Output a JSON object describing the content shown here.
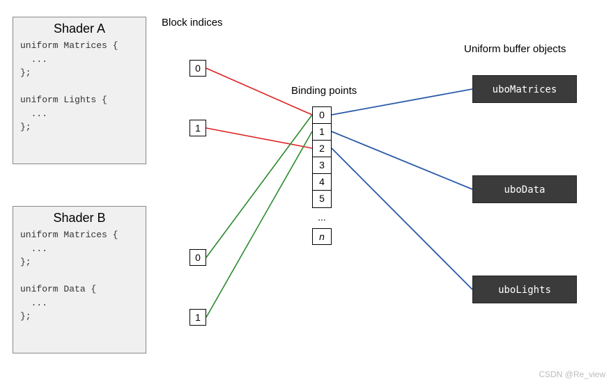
{
  "shaderA": {
    "title": "Shader A",
    "code": "uniform Matrices {\n  ...\n};\n\nuniform Lights {\n  ...\n};"
  },
  "shaderB": {
    "title": "Shader B",
    "code": "uniform Matrices {\n  ...\n};\n\nuniform Data {\n  ...\n};"
  },
  "labels": {
    "blockIndices": "Block indices",
    "bindingPoints": "Binding points",
    "ubo": "Uniform buffer objects"
  },
  "blockIdx": {
    "a0": "0",
    "a1": "1",
    "b0": "0",
    "b1": "1"
  },
  "bindPts": {
    "p0": "0",
    "p1": "1",
    "p2": "2",
    "p3": "3",
    "p4": "4",
    "p5": "5",
    "dots": "...",
    "n": "n"
  },
  "ubo": {
    "matrices": "uboMatrices",
    "data": "uboData",
    "lights": "uboLights"
  },
  "watermark": "CSDN @Re_view",
  "chart_data": {
    "type": "diagram",
    "title": "Uniform buffer object binding diagram",
    "shaders": [
      {
        "name": "Shader A",
        "blocks": [
          {
            "name": "Matrices",
            "block_index": 0,
            "binding_point": 0
          },
          {
            "name": "Lights",
            "block_index": 1,
            "binding_point": 2
          }
        ]
      },
      {
        "name": "Shader B",
        "blocks": [
          {
            "name": "Matrices",
            "block_index": 0,
            "binding_point": 0
          },
          {
            "name": "Data",
            "block_index": 1,
            "binding_point": 1
          }
        ]
      }
    ],
    "binding_points": [
      0,
      1,
      2,
      3,
      4,
      5,
      "...",
      "n"
    ],
    "uniform_buffer_objects": [
      {
        "name": "uboMatrices",
        "binding_point": 0
      },
      {
        "name": "uboData",
        "binding_point": 1
      },
      {
        "name": "uboLights",
        "binding_point": 2
      }
    ],
    "line_colors": {
      "ShaderA": "#d22",
      "ShaderB": "#2a8a2a",
      "UBO": "#2a5aa8"
    }
  }
}
